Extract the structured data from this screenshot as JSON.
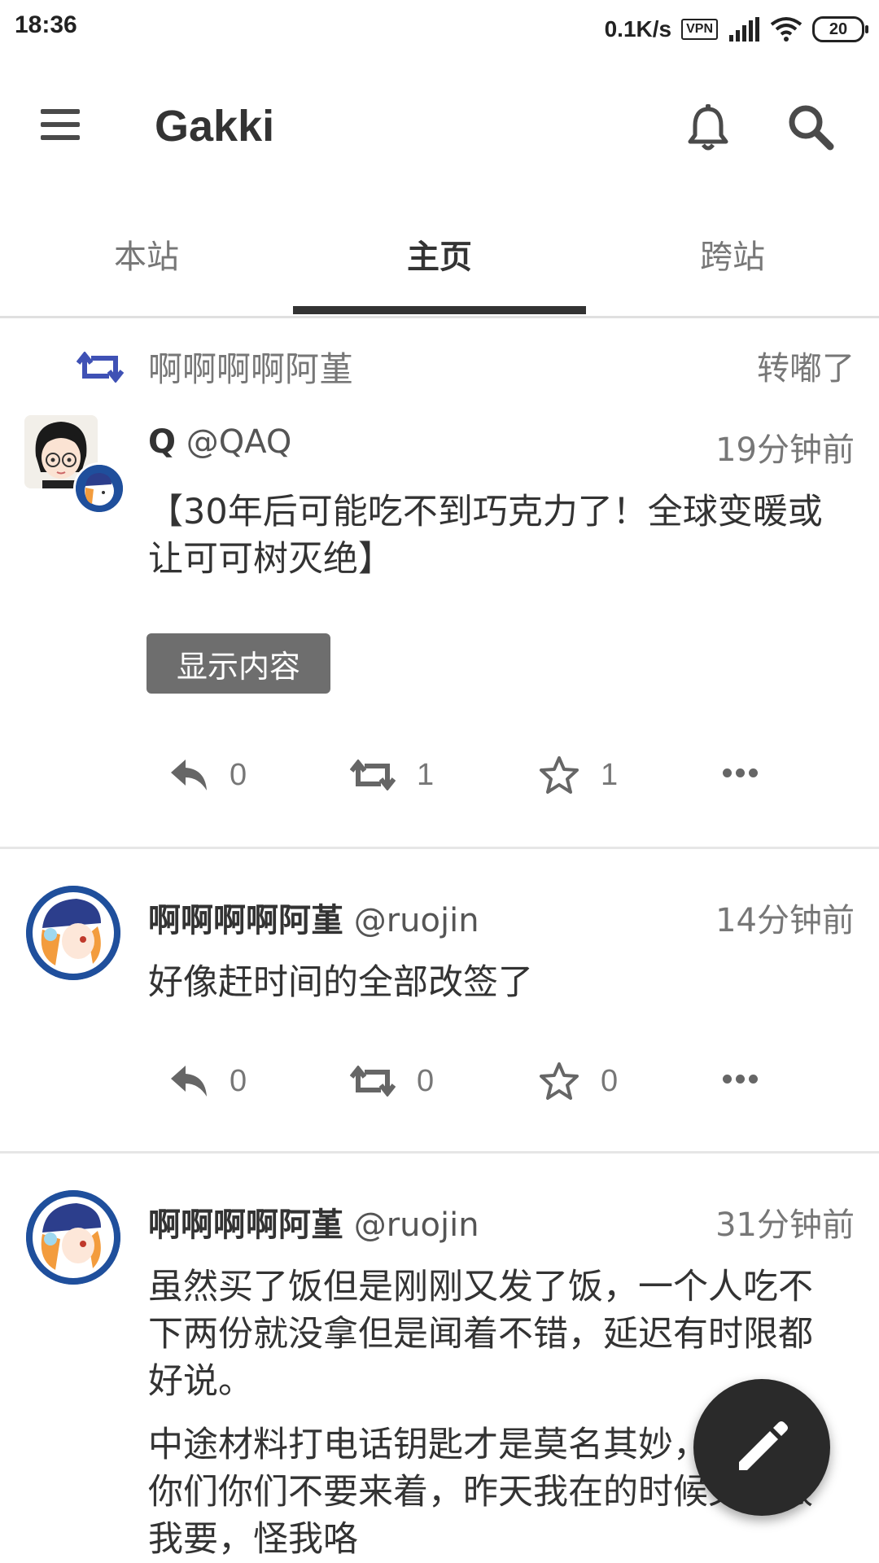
{
  "status_bar": {
    "time": "18:36",
    "net_speed": "0.1K/s",
    "vpn": "VPN",
    "battery": "20"
  },
  "app_bar": {
    "title": "Gakki",
    "icons": [
      "menu-icon",
      "bell-icon",
      "search-icon"
    ]
  },
  "tabs": [
    {
      "label": "本站",
      "active": false
    },
    {
      "label": "主页",
      "active": true
    },
    {
      "label": "跨站",
      "active": false
    }
  ],
  "posts": [
    {
      "boosted_by": "啊啊啊啊阿堇",
      "boost_label": "转嘟了",
      "display_name": "Q",
      "handle": "@QAQ",
      "time": "19分钟前",
      "content": "【30年后可能吃不到巧克力了！全球变暖或让可可树灭绝】",
      "show_button": "显示内容",
      "replies": "0",
      "boosts": "1",
      "favourites": "1"
    },
    {
      "display_name": "啊啊啊啊阿堇",
      "handle": "@ruojin",
      "time": "14分钟前",
      "content": "好像赶时间的全部改签了",
      "replies": "0",
      "boosts": "0",
      "favourites": "0"
    },
    {
      "display_name": "啊啊啊啊阿堇",
      "handle": "@ruojin",
      "time": "31分钟前",
      "content_p1": "虽然买了饭但是刚刚又发了饭，一个人吃不下两份就没拿但是闻着不错，延迟有时限都好说。",
      "content_p2": "中途材料打电话钥匙才是莫名其妙，当初给你们你们不要来着，昨天我在的时候又没跟我要，怪我咯"
    }
  ],
  "colors": {
    "accent_boost": "#3f51b5",
    "text_primary": "#333333",
    "text_secondary": "#777777",
    "fab": "#2a2a2a"
  }
}
